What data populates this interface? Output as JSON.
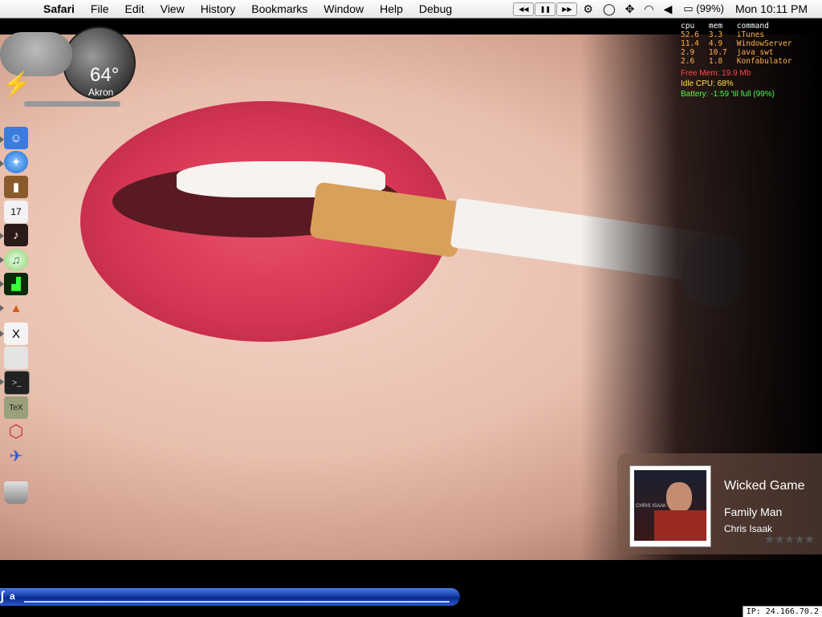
{
  "menubar": {
    "app_name": "Safari",
    "items": [
      "File",
      "Edit",
      "View",
      "History",
      "Bookmarks",
      "Window",
      "Help",
      "Debug"
    ],
    "battery": "(99%)",
    "clock": "Mon 10:11 PM"
  },
  "weather": {
    "temperature": "64°",
    "city": "Akron"
  },
  "stats": {
    "headers": [
      "cpu",
      "mem",
      "command"
    ],
    "rows": [
      {
        "cpu": "52.6",
        "mem": "3.3",
        "command": "iTunes"
      },
      {
        "cpu": "11.4",
        "mem": "4.9",
        "command": "WindowServer"
      },
      {
        "cpu": "2.9",
        "mem": "10.7",
        "command": "java_swt"
      },
      {
        "cpu": "2.6",
        "mem": "1.8",
        "command": "Konfabulator"
      }
    ],
    "free_mem": "Free Mem: 19.9 Mb",
    "idle_cpu": "Idle CPU: 68%",
    "battery": "Battery: -1:59 'til full (99%)",
    "colors": {
      "free_mem": "#ff4a4a",
      "idle_cpu": "#ffe14a",
      "battery": "#4aff4a"
    }
  },
  "now_playing": {
    "title": "Wicked Game",
    "album": "Family Man",
    "artist": "Chris Isaak",
    "rating": "★★★★★",
    "cover_text": "CHRIS ISAAK"
  },
  "taskbar": {
    "label": "a"
  },
  "ip": "IP: 24.166.70.2"
}
